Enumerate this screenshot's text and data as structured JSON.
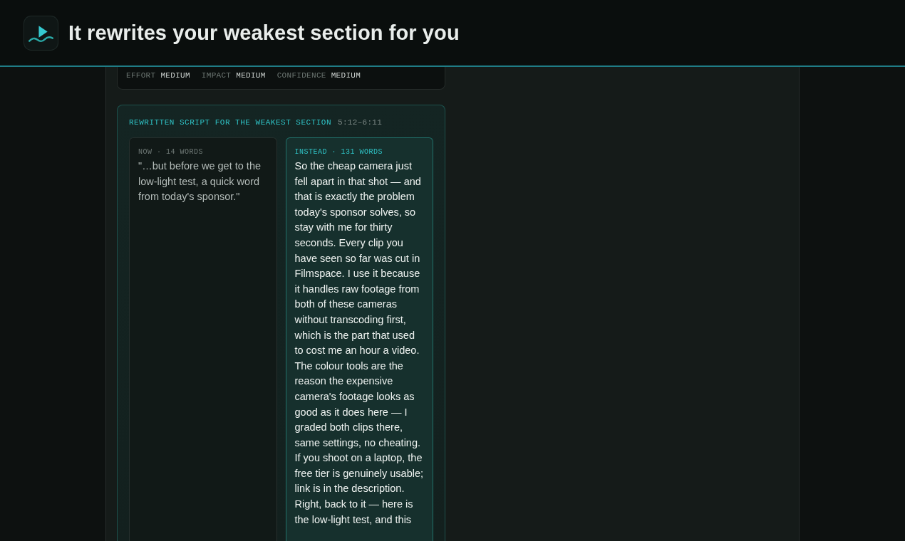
{
  "header": {
    "title": "It rewrites your weakest section for you"
  },
  "ratings": [
    {
      "label": "EFFORT",
      "value": "MEDIUM"
    },
    {
      "label": "IMPACT",
      "value": "MEDIUM"
    },
    {
      "label": "CONFIDENCE",
      "value": "MEDIUM"
    }
  ],
  "rewrite": {
    "title": "REWRITTEN SCRIPT FOR THE WEAKEST SECTION",
    "time_range": "5:12–6:11",
    "panels": [
      {
        "kind": "current",
        "label": "NOW · 14 WORDS",
        "text": "\"…but before we get to the low-light test, a quick word from today's sponsor.\""
      },
      {
        "kind": "rewrite",
        "label": "INSTEAD · 131 WORDS",
        "text": "So the cheap camera just fell apart in that shot — and that is exactly the problem today's sponsor solves, so stay with me for thirty seconds. Every clip you have seen so far was cut in Filmspace. I use it because it handles raw footage from both of these cameras without transcoding first, which is the part that used to cost me an hour a video. The colour tools are the reason the expensive camera's footage looks as good as it does here — I graded both clips there, same settings, no cheating. If you shoot on a laptop, the free tier is genuinely usable; link is in the description. Right, back to it — here is the low-light test, and this"
      }
    ]
  }
}
